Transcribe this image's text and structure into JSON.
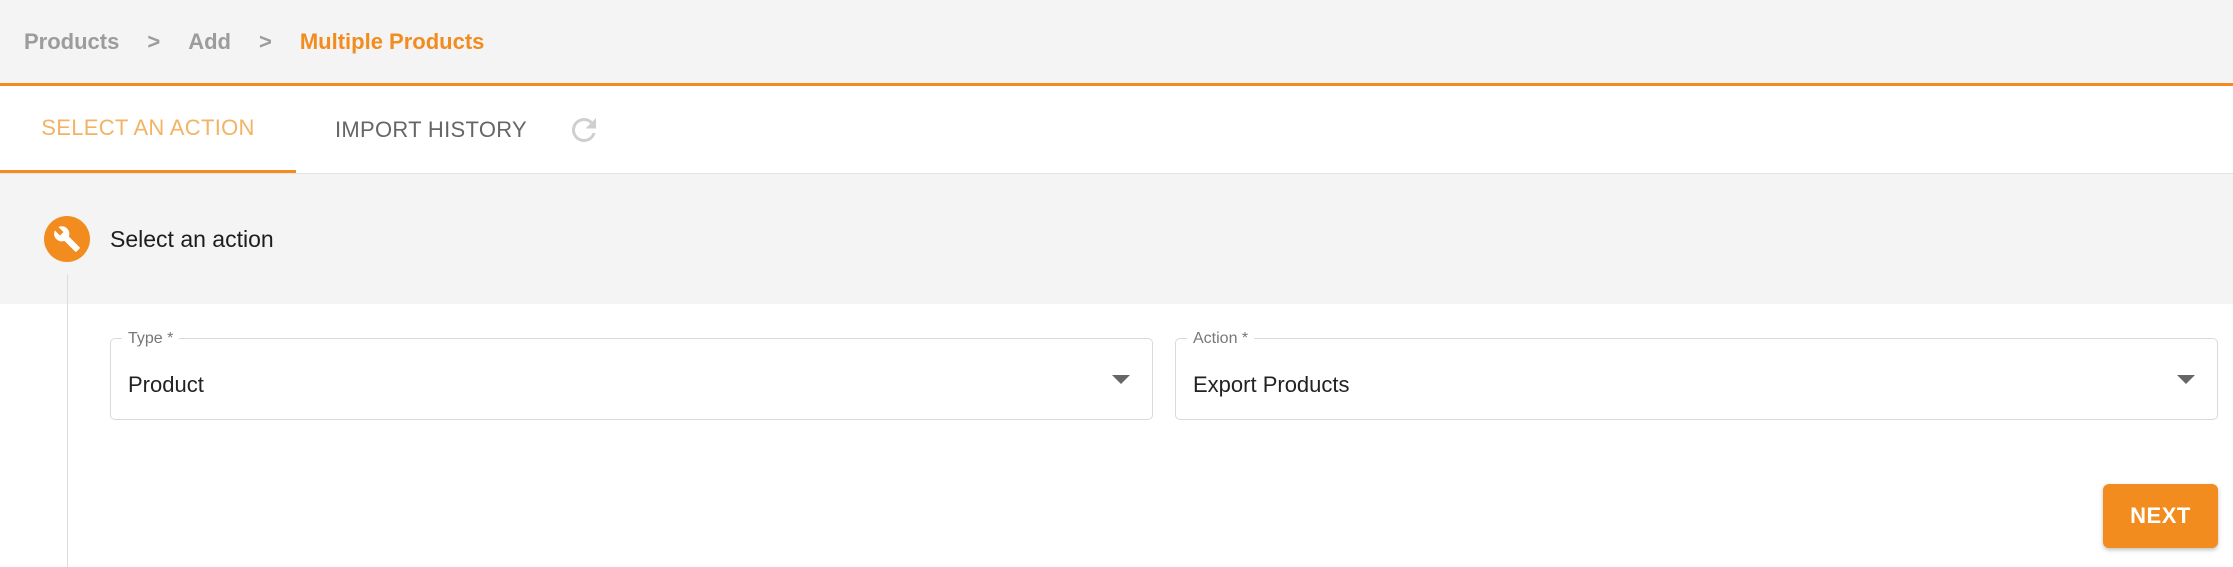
{
  "breadcrumb": {
    "items": [
      "Products",
      "Add",
      "Multiple Products"
    ],
    "separator": ">"
  },
  "tabs": [
    {
      "label": "SELECT AN ACTION",
      "active": true
    },
    {
      "label": "IMPORT HISTORY",
      "active": false
    }
  ],
  "icons": {
    "refresh": "refresh-icon",
    "step": "wrench-icon",
    "dropdown": "caret-down-icon"
  },
  "step": {
    "title": "Select an action"
  },
  "form": {
    "type": {
      "label": "Type *",
      "value": "Product"
    },
    "action": {
      "label": "Action *",
      "value": "Export Products"
    }
  },
  "buttons": {
    "next": "NEXT"
  },
  "colors": {
    "accent": "#f28c1e",
    "accent_light": "#f2b365",
    "muted": "#9c9c9c",
    "panel": "#f4f4f4"
  }
}
